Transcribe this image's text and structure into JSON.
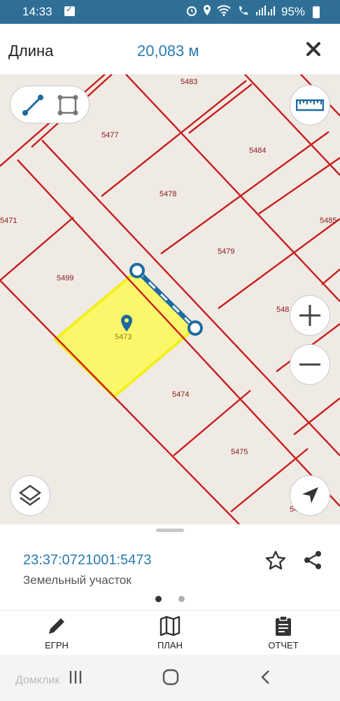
{
  "status_bar": {
    "time": "14:33",
    "battery": "95%",
    "icons": [
      "message-icon",
      "alarm-icon",
      "location-icon",
      "wifi-icon",
      "call-icon",
      "signal-icon",
      "battery-icon"
    ]
  },
  "header": {
    "title": "Длина",
    "length_value": "20,083 м",
    "close_icon": "close-icon"
  },
  "map": {
    "parcels": [
      {
        "id": "5483",
        "label": "5483"
      },
      {
        "id": "5477",
        "label": "5477"
      },
      {
        "id": "5484",
        "label": "5484"
      },
      {
        "id": "5478",
        "label": "5478"
      },
      {
        "id": "5471",
        "label": "5471"
      },
      {
        "id": "5485",
        "label": "5485"
      },
      {
        "id": "5479",
        "label": "5479"
      },
      {
        "id": "5499",
        "label": "5499"
      },
      {
        "id": "548x",
        "label": "548"
      },
      {
        "id": "5473",
        "label": "5473"
      },
      {
        "id": "5474",
        "label": "5474"
      },
      {
        "id": "5475",
        "label": "5475"
      },
      {
        "id": "54xx",
        "label": "54"
      }
    ],
    "selected_parcel": "5473",
    "colors": {
      "boundary": "#c81e1e",
      "selected_fill": "#fbf76a",
      "selected_stroke": "#f3ef1b",
      "measure_line": "#1e6aa0",
      "background": "#efeae4"
    }
  },
  "map_controls": {
    "line_mode_icon": "line-measure-icon",
    "area_mode_icon": "area-measure-icon",
    "ruler_icon": "ruler-icon",
    "zoom_in_icon": "plus-icon",
    "zoom_out_icon": "minus-icon",
    "layers_icon": "layers-icon",
    "locate_icon": "navigation-arrow-icon"
  },
  "sheet": {
    "cadastral_number": "23:37:0721001:5473",
    "object_type": "Земельный участок",
    "page_count": 2,
    "active_page": 1
  },
  "bottom_nav": {
    "items": [
      {
        "label": "ЕГРН",
        "icon": "pencil-icon"
      },
      {
        "label": "ПЛАН",
        "icon": "map-icon"
      },
      {
        "label": "ОТЧЕТ",
        "icon": "clipboard-icon"
      }
    ]
  },
  "system_nav": {
    "watermark": "Домклик"
  }
}
